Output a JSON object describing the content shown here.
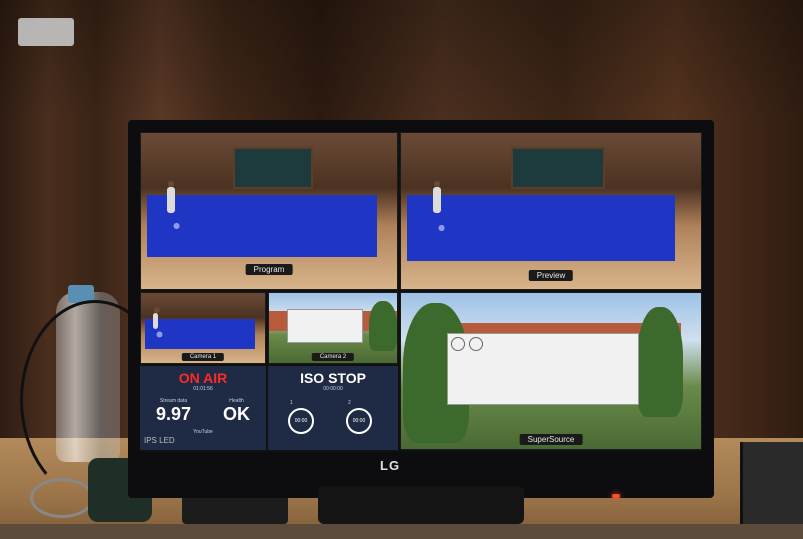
{
  "multiview": {
    "program_label": "Program",
    "preview_label": "Preview",
    "camera1_label": "Camera 1",
    "camera2_label": "Camera 2",
    "supersource_label": "SuperSource"
  },
  "record_panel": {
    "status": "ON AIR",
    "timecode": "01:01:56",
    "bitrate_caption": "Stream data",
    "bitrate_value": "9.97",
    "state_caption": "Health",
    "state_value": "OK",
    "platform": "YouTube"
  },
  "iso_panel": {
    "status": "ISO STOP",
    "timecode": "00:00:00",
    "dial1": "00:00",
    "dial2": "00:00",
    "dial1_label": "1",
    "dial2_label": "2"
  },
  "monitor": {
    "brand": "LG",
    "panel_type": "IPS LED"
  },
  "colors": {
    "onair_red": "#ff2a2a",
    "tablecloth_blue": "#1f36c4",
    "status_panel": "#1f2a44"
  }
}
